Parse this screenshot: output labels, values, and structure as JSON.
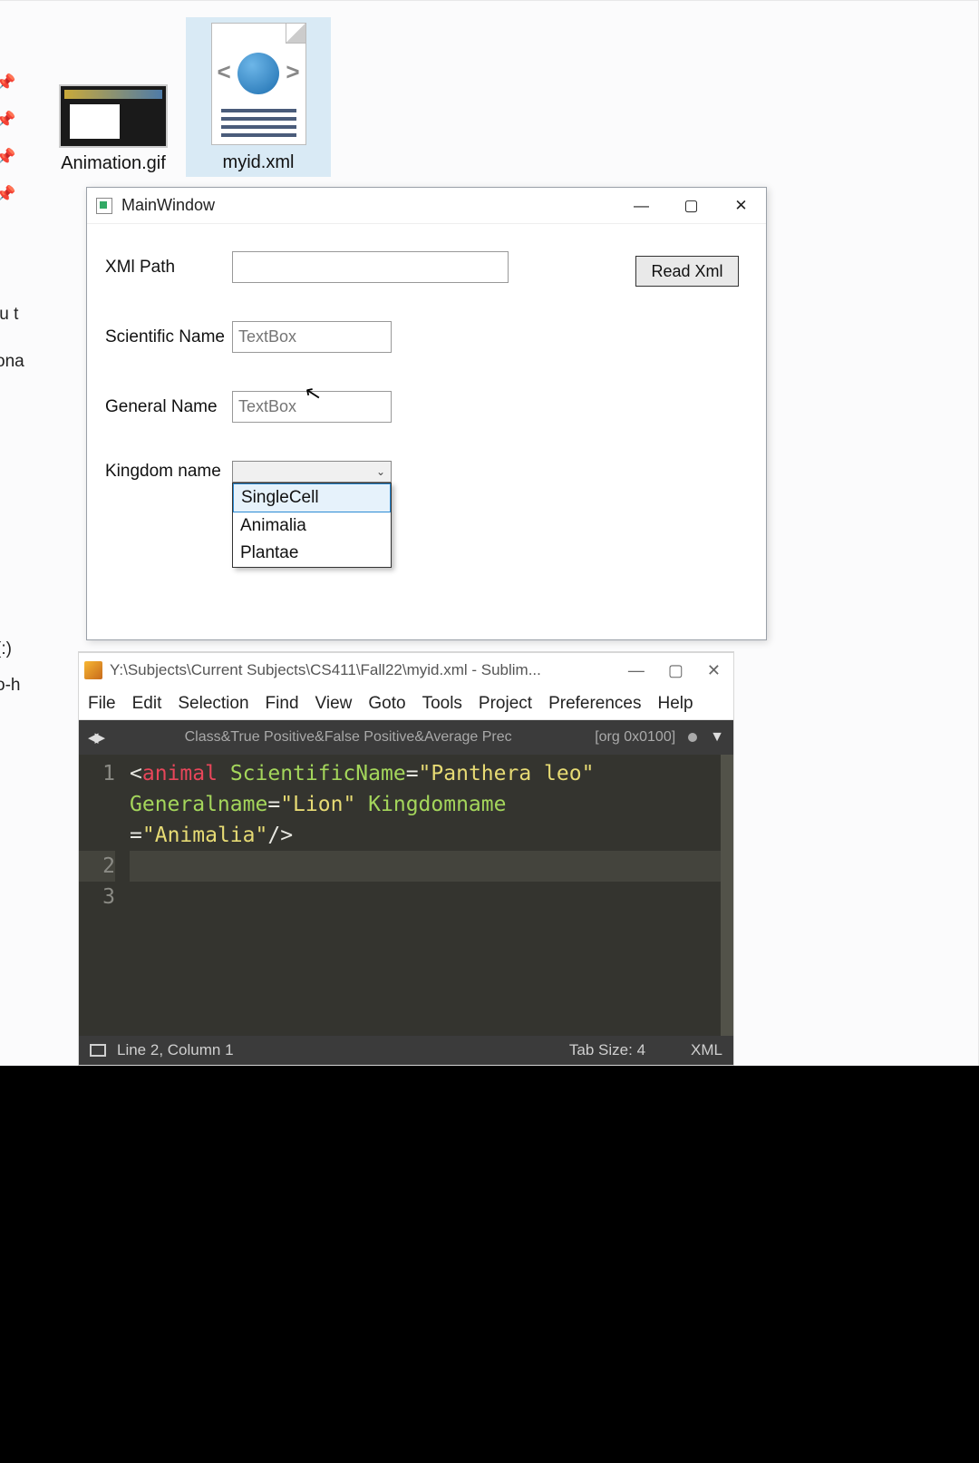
{
  "desktop": {
    "files": [
      {
        "name": "Animation.gif"
      },
      {
        "name": "myid.xml"
      }
    ],
    "side_fragments": {
      "a": "lu t",
      "b": "ona",
      "c": "(:)",
      "d": "o-h"
    }
  },
  "mainwindow": {
    "title": "MainWindow",
    "labels": {
      "xml_path": "XMl Path",
      "scientific_name": "Scientific Name",
      "general_name": "General Name",
      "kingdom_name": "Kingdom name"
    },
    "readxml_button": "Read Xml",
    "placeholders": {
      "scientific": "TextBox",
      "general": "TextBox"
    },
    "kingdom_options": [
      "SingleCell",
      "Animalia",
      "Plantae"
    ],
    "kingdom_highlight_index": 0
  },
  "sublime": {
    "title": "Y:\\Subjects\\Current Subjects\\CS411\\Fall22\\myid.xml - Sublim...",
    "menu": [
      "File",
      "Edit",
      "Selection",
      "Find",
      "View",
      "Goto",
      "Tools",
      "Project",
      "Preferences",
      "Help"
    ],
    "tab_name": "Class&True Positive&False Positive&Average Prec",
    "tab_tag": "[org 0x0100]",
    "code": {
      "lines": [
        "1",
        "2",
        "3"
      ],
      "element": "animal",
      "attrs": {
        "ScientificName": "Panthera leo",
        "Generalname": "Lion",
        "Kingdomname": "Animalia"
      }
    },
    "status": {
      "left": "Line 2, Column 1",
      "tab_size": "Tab Size: 4",
      "lang": "XML"
    }
  }
}
